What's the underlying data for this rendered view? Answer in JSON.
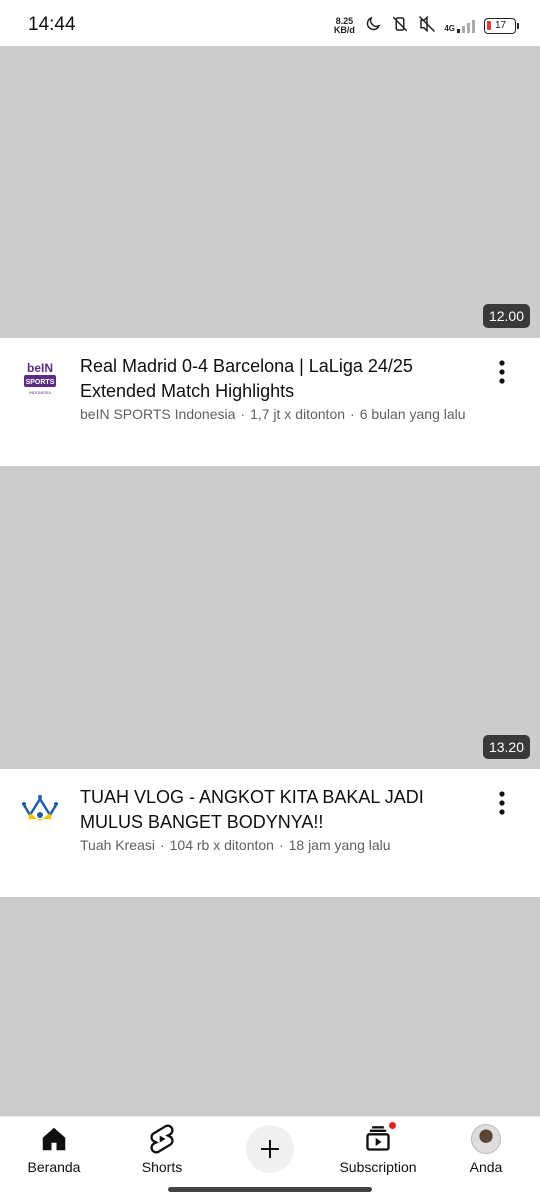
{
  "status_bar": {
    "time": "14:44",
    "net_speed_value": "8.25",
    "net_speed_unit": "KB/d",
    "network": "4G",
    "battery_level": "17"
  },
  "videos": [
    {
      "duration": "12.00",
      "title": "Real Madrid 0-4 Barcelona | LaLiga 24/25 Extended Match Highlights",
      "channel": "beIN SPORTS Indonesia",
      "views": "1,7 jt x ditonton",
      "age": "6 bulan yang lalu",
      "avatar_icon": "bein-sports-logo",
      "avatar_text_1": "beIN",
      "avatar_text_2": "SPORTS",
      "avatar_text_3": "INDONESIA"
    },
    {
      "duration": "13.20",
      "title": "TUAH VLOG - ANGKOT KITA BAKAL JADI MULUS BANGET BODYNYA!!",
      "channel": "Tuah Kreasi",
      "views": "104 rb x ditonton",
      "age": "18 jam yang lalu",
      "avatar_icon": "crown-logo"
    }
  ],
  "bottom_nav": {
    "home": "Beranda",
    "shorts": "Shorts",
    "subscription": "Subscription",
    "you": "Anda"
  },
  "colors": {
    "thumbnail_placeholder": "#cccccc",
    "notification_dot": "#e3261f",
    "meta_text": "#606060"
  }
}
